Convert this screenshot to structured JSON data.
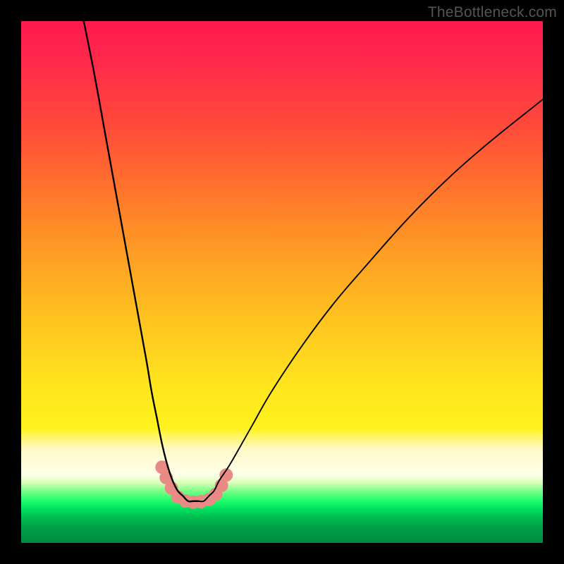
{
  "watermark": "TheBottleneck.com",
  "chart_data": {
    "type": "line",
    "title": "",
    "xlabel": "",
    "ylabel": "",
    "xlim": [
      0,
      100
    ],
    "ylim": [
      0,
      100
    ],
    "grid": false,
    "legend": false,
    "series": [
      {
        "name": "left-curve",
        "x": [
          12,
          14,
          16,
          18,
          20,
          22,
          24,
          25,
          26,
          27,
          28,
          29,
          30,
          31,
          32,
          33,
          34
        ],
        "y": [
          100,
          90,
          79,
          68,
          57,
          46,
          35,
          29,
          24,
          19,
          15,
          12,
          10,
          9,
          8,
          8,
          8
        ]
      },
      {
        "name": "right-curve",
        "x": [
          34,
          35,
          36,
          37,
          38,
          40,
          44,
          48,
          54,
          60,
          66,
          74,
          82,
          90,
          100
        ],
        "y": [
          8,
          8,
          9,
          10,
          12,
          15,
          22,
          29,
          38,
          46,
          53,
          62,
          70,
          77,
          85
        ]
      }
    ],
    "markers": {
      "name": "salmon-dots",
      "color": "#e98b84",
      "points": [
        {
          "x": 27.0,
          "y": 14.5
        },
        {
          "x": 27.8,
          "y": 12.5
        },
        {
          "x": 28.8,
          "y": 10.5
        },
        {
          "x": 30.0,
          "y": 8.8
        },
        {
          "x": 31.5,
          "y": 8.0
        },
        {
          "x": 33.0,
          "y": 7.8
        },
        {
          "x": 34.5,
          "y": 7.9
        },
        {
          "x": 36.0,
          "y": 8.3
        },
        {
          "x": 37.3,
          "y": 9.3
        },
        {
          "x": 38.4,
          "y": 11.0
        },
        {
          "x": 39.3,
          "y": 13.0
        }
      ]
    },
    "background_gradient": {
      "top": "#ff1a4d",
      "mid": "#ffe51e",
      "band": "#fffde0",
      "green": "#1aff6a",
      "bottom": "#008a40"
    }
  }
}
